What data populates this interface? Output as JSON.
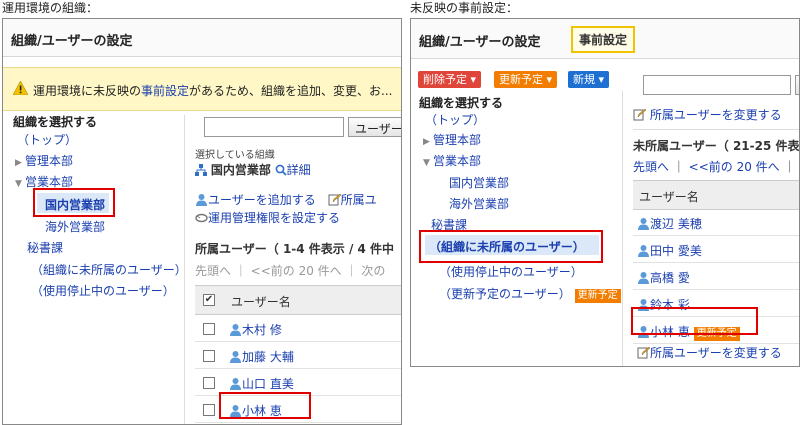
{
  "left": {
    "caption": "運用環境の組織：",
    "title": "組織/ユーザーの設定",
    "warning_text": "運用環境に未反映の",
    "warning_link": "事前設定",
    "warning_text2": "があるため、組織を追加、変更、お...",
    "tree_heading": "組織を選択する",
    "tree": {
      "top": "（トップ）",
      "kanri": "管理本部",
      "eigyo": "営業本部",
      "kokunai": "国内営業部",
      "kaigai": "海外営業部",
      "hisho": "秘書課",
      "unassigned": "（組織に未所属のユーザー）",
      "suspended": "（使用停止中のユーザー）"
    },
    "search_button": "ユーザー",
    "selected_label": "選択している組織",
    "selected_org": "国内営業部",
    "detail_link": "詳細",
    "add_user": "ユーザーを追加する",
    "shozoku_link": "所属ユ",
    "admin_rights": "運用管理権限を設定する",
    "members_label": "所属ユーザー（ 1-4 件表示 / 4 件中",
    "pager": {
      "first": "先頭へ",
      "prev": "<<前の 20 件へ",
      "next": "次の"
    },
    "col_header": "ユーザー名",
    "users": [
      "木村 修",
      "加藤 大輔",
      "山口 直美",
      "小林 恵"
    ]
  },
  "right": {
    "caption": "未反映の事前設定：",
    "title": "組織/ユーザーの設定",
    "badge": "事前設定",
    "buttons": {
      "delete": "削除予定",
      "update": "更新予定",
      "new": "新規"
    },
    "tree_heading": "組織を選択する",
    "tree": {
      "top": "（トップ）",
      "kanri": "管理本部",
      "eigyo": "営業本部",
      "kokunai": "国内営業部",
      "kaigai": "海外営業部",
      "hisho": "秘書課",
      "unassigned": "（組織に未所属のユーザー）",
      "suspended": "（使用停止中のユーザー）",
      "pending": "（更新予定のユーザー）"
    },
    "pending_badge": "更新予定",
    "change_link": "所属ユーザーを変更する",
    "unassigned_label": "未所属ユーザー（ 21-25 件表",
    "pager": {
      "first": "先頭へ",
      "prev": "<<前の 20 件へ"
    },
    "col_header": "ユーザー名",
    "users": [
      "渡辺 美穂",
      "田中 愛美",
      "高橋 愛",
      "鈴木 彩",
      "小林 恵"
    ],
    "user_badge": "更新予定",
    "change_link_bottom": "所属ユーザーを変更する"
  },
  "colors": {
    "link": "#1a3fae",
    "highlight": "#dbe8f7",
    "red_outline": "#e00000",
    "orange": "#f27d00",
    "blue_button": "#1d6fd1",
    "red_button": "#e0453a",
    "warning_bg": "#fff8c6"
  }
}
